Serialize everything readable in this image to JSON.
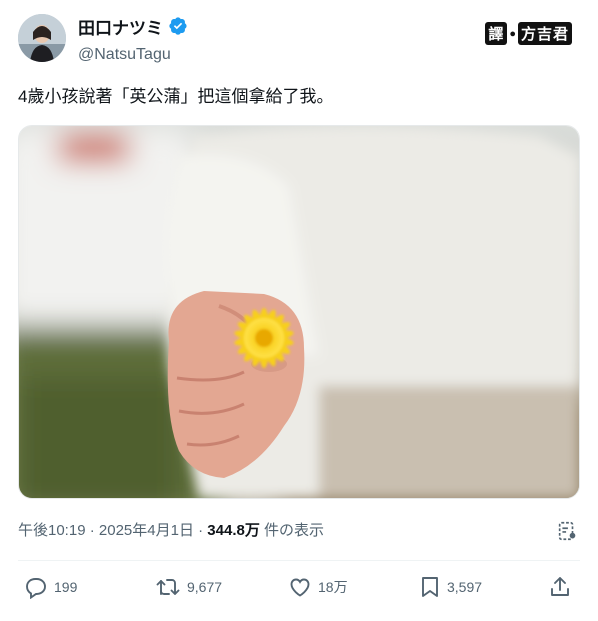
{
  "user": {
    "display_name": "田口ナツミ",
    "handle": "@NatsuTagu",
    "verified": true
  },
  "badge": {
    "text_left": "譯",
    "text_right": "方吉君"
  },
  "tweet": {
    "text": "4歲小孩說著「英公蒲」把這個拿給了我。"
  },
  "meta": {
    "time": "午後10:19",
    "separator": " · ",
    "date": "2025年4月1日",
    "separator2": " · ",
    "views": "344.8万",
    "views_label": " 件の表示"
  },
  "actions": {
    "replies": "199",
    "retweets": "9,677",
    "likes": "18万",
    "bookmarks": "3,597"
  },
  "colors": {
    "verified": "#1d9bf0",
    "text": "#0f1419",
    "secondary": "#536471"
  }
}
